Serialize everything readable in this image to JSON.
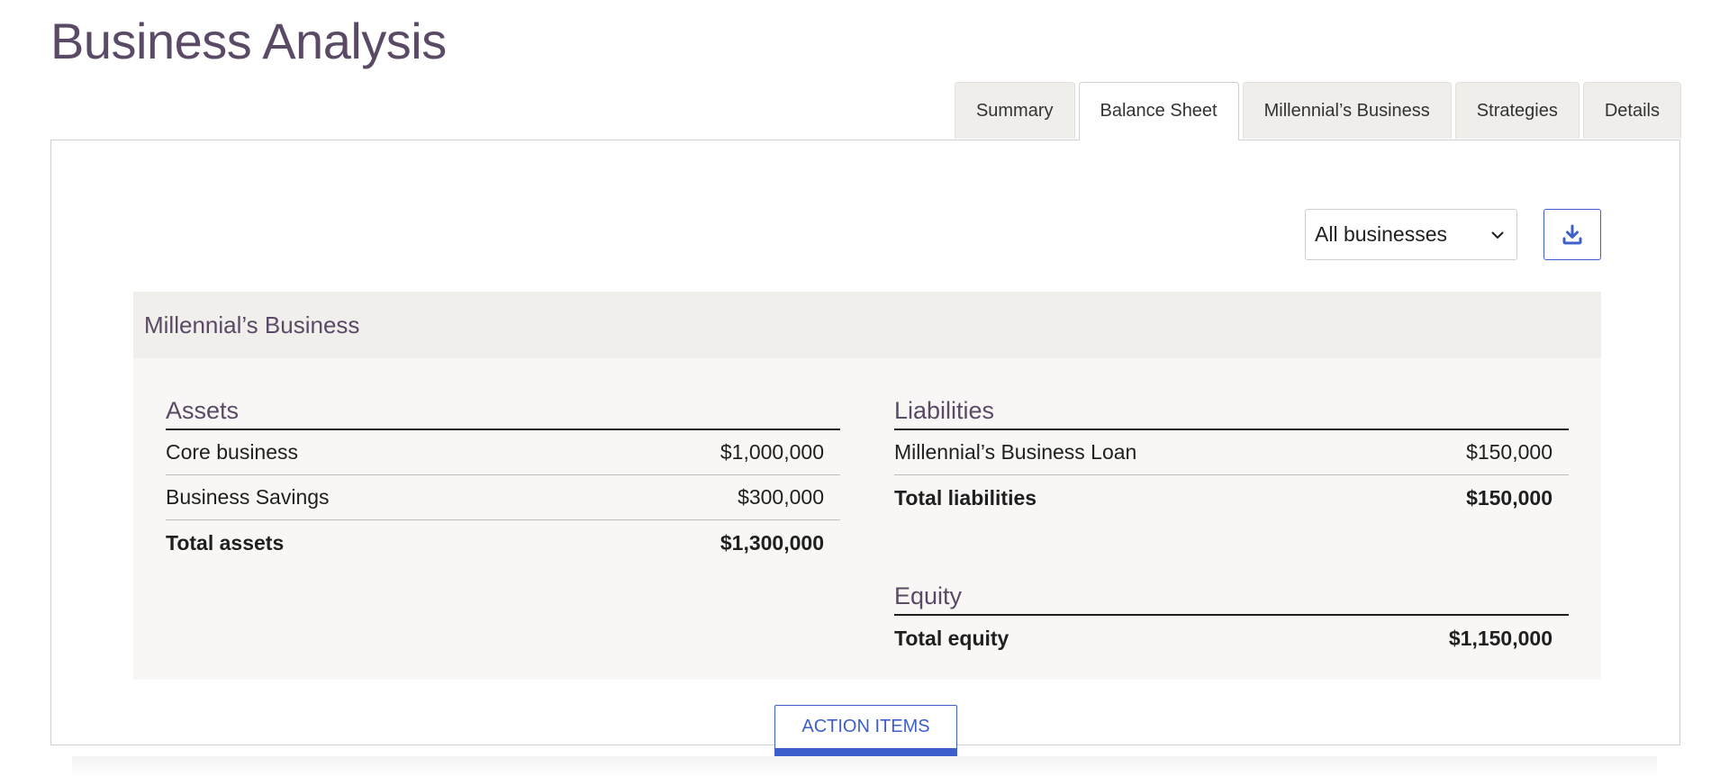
{
  "page": {
    "title": "Business Analysis"
  },
  "tabs": [
    {
      "label": "Summary",
      "active": false
    },
    {
      "label": "Balance Sheet",
      "active": true
    },
    {
      "label": "Millennial’s Business",
      "active": false
    },
    {
      "label": "Strategies",
      "active": false
    },
    {
      "label": "Details",
      "active": false
    }
  ],
  "filter": {
    "selected": "All businesses",
    "icon": "chevron-down-icon"
  },
  "download": {
    "icon": "download-icon"
  },
  "card": {
    "title": "Millennial’s Business",
    "assets": {
      "title": "Assets",
      "rows": [
        {
          "label": "Core business",
          "value": "$1,000,000"
        },
        {
          "label": "Business Savings",
          "value": "$300,000"
        }
      ],
      "total": {
        "label": "Total assets",
        "value": "$1,300,000"
      }
    },
    "liabilities": {
      "title": "Liabilities",
      "rows": [
        {
          "label": "Millennial’s Business Loan",
          "value": "$150,000"
        }
      ],
      "total": {
        "label": "Total liabilities",
        "value": "$150,000"
      }
    },
    "equity": {
      "title": "Equity",
      "total": {
        "label": "Total equity",
        "value": "$1,150,000"
      }
    }
  },
  "actions": {
    "label": "ACTION ITEMS"
  },
  "colors": {
    "accent": "#3d5fcc",
    "heading": "#5a4a66",
    "tab_bg": "#f0eeeb",
    "card_bg": "#f8f7f5"
  }
}
